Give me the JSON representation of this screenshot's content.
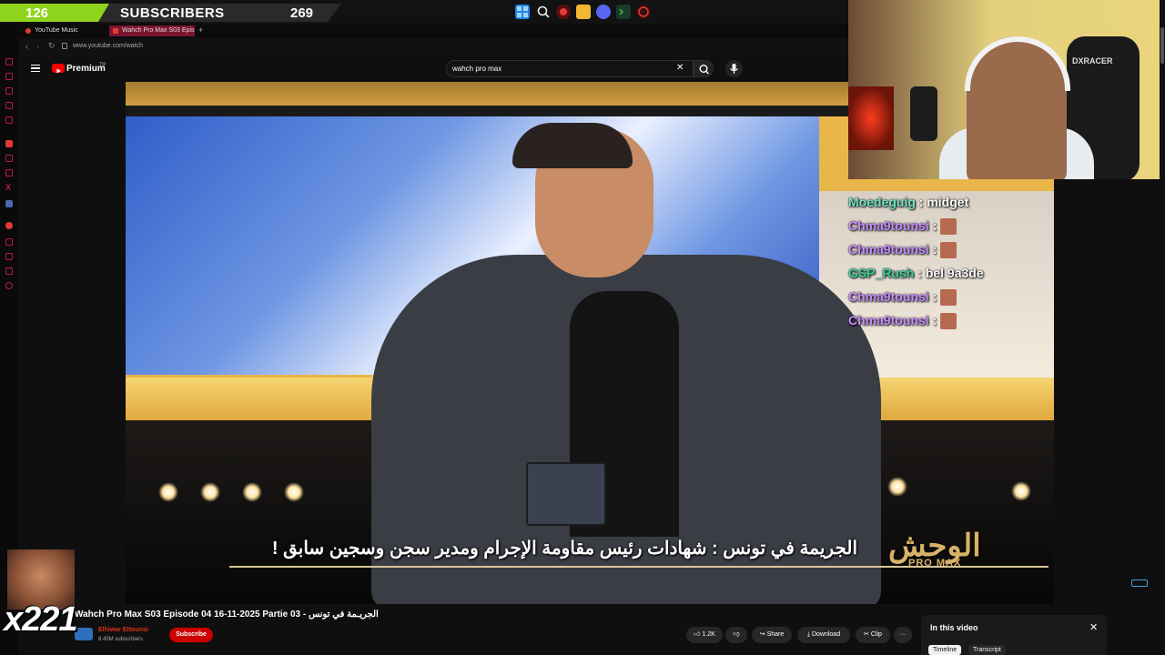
{
  "overlay": {
    "sub_current": "126",
    "sub_label": "SUBSCRIBERS",
    "sub_target": "269",
    "sub_progress": 0.47
  },
  "taskbar": {
    "icons": [
      "windows-icon",
      "search-icon",
      "record-icon",
      "folder-icon",
      "discord-icon",
      "terminal-icon",
      "game-icon"
    ]
  },
  "browser": {
    "tabs": [
      {
        "label": "YouTube Music",
        "active": false
      },
      {
        "label": "Wahch Pro Max S03 Epis",
        "active": true
      }
    ],
    "url": "www.youtube.com/watch",
    "new_tab": "+"
  },
  "youtube": {
    "logo_text": "Premium",
    "logo_sup": "TM",
    "search_value": "wahch pro max",
    "clear": "✕"
  },
  "video": {
    "subtitle": "الجريمة في تونس : شهادات رئيس مقاومة الإجرام ومدير سجن وسجين سابق !",
    "logo_ar": "الوحش",
    "logo_en": "PRO MAX"
  },
  "webcam": {
    "chair_text": "DXRACER"
  },
  "chat": [
    {
      "user": "Moedeguig",
      "color": "#6fe3c0",
      "message": "midget",
      "emote": false
    },
    {
      "user": "Chma9tounsi",
      "color": "#c58cff",
      "message": "",
      "emote": true
    },
    {
      "user": "Chma9tounsi",
      "color": "#c58cff",
      "message": "",
      "emote": true
    },
    {
      "user": "GSP_Rush",
      "color": "#38d19a",
      "message": "bel 9a3de",
      "emote": false
    },
    {
      "user": "Chma9tounsi",
      "color": "#c58cff",
      "message": "",
      "emote": true
    },
    {
      "user": "Chma9tounsi",
      "color": "#c58cff",
      "message": "",
      "emote": true
    }
  ],
  "below": {
    "title": "Wahch Pro Max S03 Episode 04 16-11-2025 Partie 03 - الجريـمة في تونس",
    "channel": "Elhiwar Ettounsi",
    "subs": "8.45M subscribers",
    "subscribe": "Subscribe",
    "likes": "1.2K",
    "share": "Share",
    "download": "Download",
    "clip": "Clip",
    "more": "···"
  },
  "panel": {
    "title": "In this video",
    "close": "✕",
    "tabs": [
      "Timeline",
      "Transcript"
    ]
  },
  "emote": {
    "count": "x221"
  },
  "colors": {
    "accent": "#8fd41c",
    "yt_red": "#cc0000",
    "sidebar_icon": "#c2184b"
  }
}
